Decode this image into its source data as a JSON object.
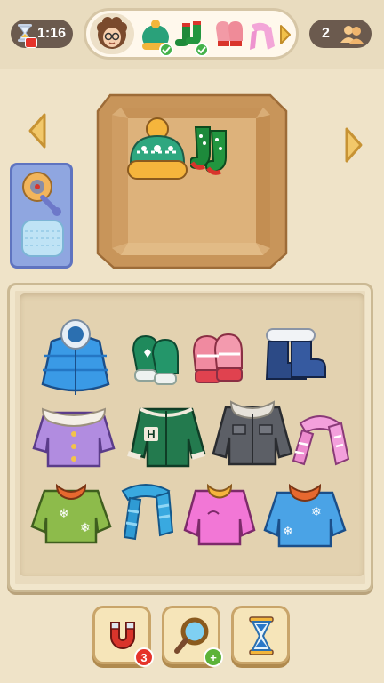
{
  "hud": {
    "timer": "1:16",
    "players": "2"
  },
  "order": {
    "items": [
      {
        "name": "beanie",
        "done": true
      },
      {
        "name": "socks",
        "done": true
      },
      {
        "name": "mittens",
        "done": false
      },
      {
        "name": "scarf",
        "done": false
      }
    ]
  },
  "box": {
    "contents": [
      "beanie",
      "socks"
    ]
  },
  "tray": {
    "rows": [
      [
        "puffer-jacket",
        "green-mittens",
        "pink-mittens",
        "blue-boots"
      ],
      [
        "purple-fur-coat",
        "varsity-jacket",
        "denim-jacket",
        "pink-scarf"
      ],
      [
        "green-sweater",
        "blue-scarf",
        "pink-sweater",
        "blue-sweater"
      ]
    ]
  },
  "boosters": [
    {
      "name": "magnet",
      "count": "3",
      "badge_color": "#e5332a"
    },
    {
      "name": "magnifier",
      "count": "+",
      "badge_color": "#5cb338"
    },
    {
      "name": "hourglass",
      "count": "",
      "badge_color": ""
    }
  ],
  "colors": {
    "background": "#efe3c8",
    "hud_pill": "#6b5a4e",
    "tray": "#e9dbbe",
    "box": "#d7ab72"
  }
}
